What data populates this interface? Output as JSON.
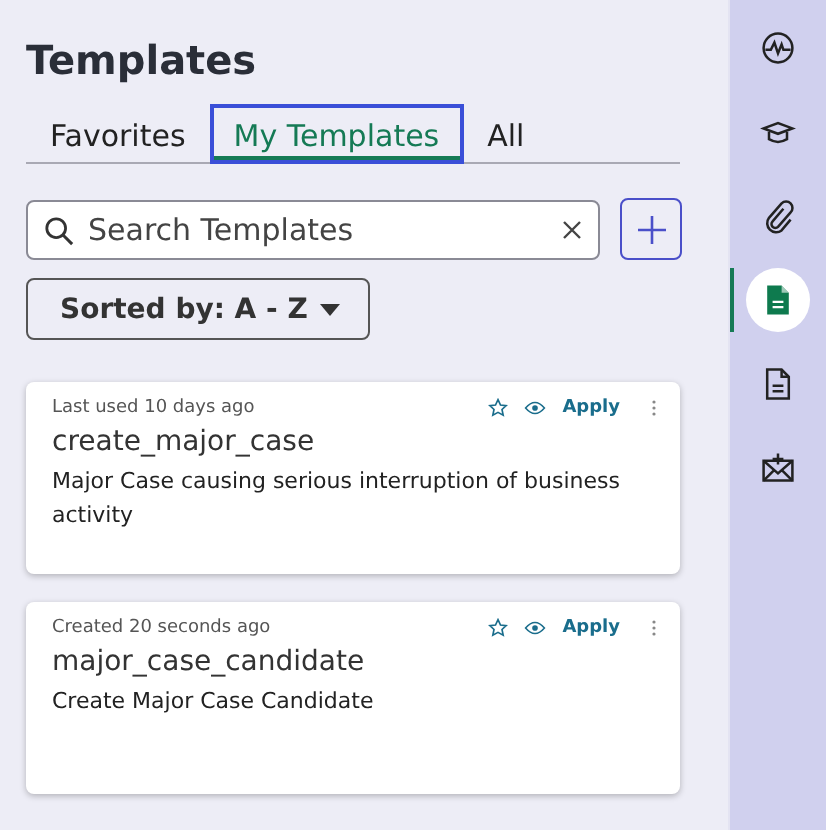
{
  "title": "Templates",
  "tabs": [
    {
      "label": "Favorites",
      "selected": false
    },
    {
      "label": "My Templates",
      "selected": true
    },
    {
      "label": "All",
      "selected": false
    }
  ],
  "search": {
    "placeholder": "Search Templates"
  },
  "sort": {
    "label": "Sorted by: A - Z"
  },
  "cards": [
    {
      "meta": "Last used 10 days ago",
      "name": "create_major_case",
      "description": "Major Case causing serious interruption of business activity",
      "action": "Apply"
    },
    {
      "meta": "Created 20 seconds ago",
      "name": "major_case_candidate",
      "description": "Create Major Case Candidate",
      "action": "Apply"
    }
  ],
  "rail": [
    {
      "kind": "pulse",
      "selected": false
    },
    {
      "kind": "cap",
      "selected": false
    },
    {
      "kind": "clip",
      "selected": false
    },
    {
      "kind": "template",
      "selected": true
    },
    {
      "kind": "document",
      "selected": false
    },
    {
      "kind": "mail",
      "selected": false
    }
  ]
}
